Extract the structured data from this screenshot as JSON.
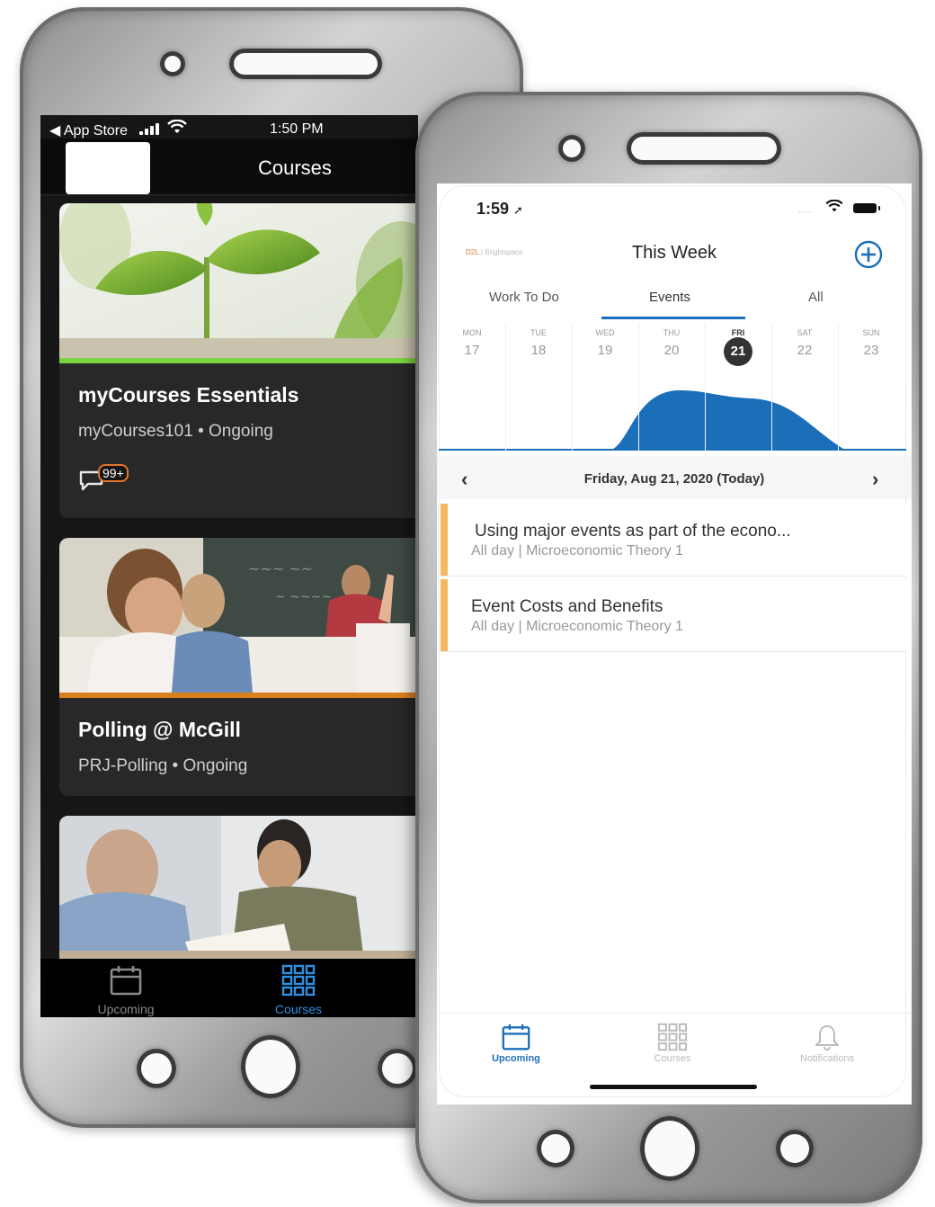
{
  "left_phone": {
    "status": {
      "back_label": "◀ App Store",
      "time": "1:50 PM"
    },
    "header": {
      "title": "Courses"
    },
    "courses": [
      {
        "title": "myCourses Essentials",
        "code": "myCourses101",
        "status": "Ongoing",
        "separator": "•",
        "badge": "99+",
        "accent": "#7bd13f"
      },
      {
        "title": "Polling @ McGill",
        "code": "PRJ-Polling",
        "status": "Ongoing",
        "separator": "•",
        "accent": "#d9801e"
      },
      {
        "title": "",
        "code": "",
        "status": ""
      }
    ],
    "tabbar": [
      {
        "label": "Upcoming",
        "icon": "calendar-icon",
        "active": false
      },
      {
        "label": "Courses",
        "icon": "grid-icon",
        "active": true
      }
    ],
    "active_color": "#2f8fe0"
  },
  "right_phone": {
    "status": {
      "time": "1:59",
      "signal_dots": "....."
    },
    "header": {
      "brand": "D2L",
      "brand_suffix": "| Brightspace",
      "title": "This Week"
    },
    "tabs": [
      "Work To Do",
      "Events",
      "All"
    ],
    "active_tab": "Events",
    "week": [
      {
        "day": "MON",
        "date": "17"
      },
      {
        "day": "TUE",
        "date": "18"
      },
      {
        "day": "WED",
        "date": "19"
      },
      {
        "day": "THU",
        "date": "20"
      },
      {
        "day": "FRI",
        "date": "21",
        "selected": true
      },
      {
        "day": "SAT",
        "date": "22"
      },
      {
        "day": "SUN",
        "date": "23"
      }
    ],
    "date_label": "Friday, Aug 21, 2020 (Today)",
    "nav": {
      "prev": "‹",
      "next": "›"
    },
    "events": [
      {
        "title": "Using major events as part of the econo...",
        "meta": "All day | Microeconomic Theory 1"
      },
      {
        "title": "Event Costs and Benefits",
        "meta": "All day | Microeconomic Theory 1"
      }
    ],
    "tabbar": [
      {
        "label": "Upcoming",
        "icon": "calendar-icon",
        "active": true
      },
      {
        "label": "Courses",
        "icon": "grid-icon",
        "active": false
      },
      {
        "label": "Notifications",
        "icon": "bell-icon",
        "active": false
      }
    ],
    "accent_color": "#1b6fb8",
    "event_accent_color": "#f4b860"
  }
}
